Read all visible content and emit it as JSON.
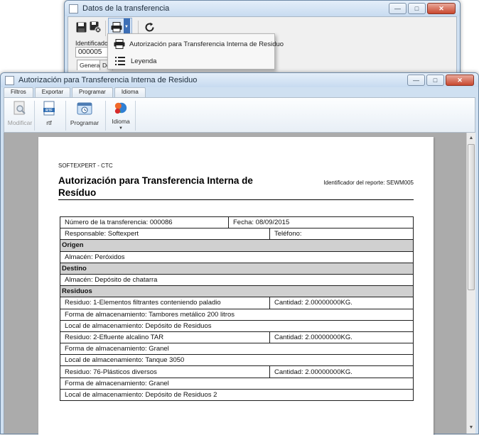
{
  "back_window": {
    "title": "Datos de la transferencia",
    "identifier_label": "Identificador",
    "identifier_value": "000005",
    "tabs": [
      "General",
      "De"
    ]
  },
  "print_menu": {
    "items": [
      {
        "label": "Autorización para Transferencia Interna de Residuo",
        "icon": "printer-icon"
      },
      {
        "label": "Leyenda",
        "icon": "list-icon"
      }
    ]
  },
  "report_window": {
    "title": "Autorización para Transferencia Interna de Residuo",
    "ribbon_tabs": [
      "Filtros",
      "Exportar",
      "Programar",
      "Idioma"
    ],
    "ribbon_buttons": [
      {
        "label": "Modificar",
        "icon": "magnifier-document-icon",
        "enabled": false
      },
      {
        "label": "rtf",
        "icon": "rtf-file-icon",
        "enabled": true
      },
      {
        "label": "Programar",
        "icon": "schedule-clock-icon",
        "enabled": true
      },
      {
        "label": "Idioma",
        "icon": "globe-language-icon",
        "enabled": true
      }
    ]
  },
  "report": {
    "company": "SOFTEXPERT - CTC",
    "title": "Autorización para Transferencia Interna de Resíduo",
    "report_id": "Identificador del reporte: SEWM005",
    "transfer_number": "Número de la transferencia: 000086",
    "date": "Fecha: 08/09/2015",
    "responsible": "Responsable: Softexpert",
    "phone": "Teléfono:",
    "origin_header": "Origen",
    "origin_warehouse": "Almacén: Peróxidos",
    "destination_header": "Destino",
    "destination_warehouse": "Almacén: Depósito de chatarra",
    "residues_header": "Residuos",
    "residues": [
      {
        "residue": "Residuo: 1-Elementos filtrantes conteniendo paladio",
        "quantity": "Cantidad: 2.00000000KG.",
        "storage_form": "Forma de almacenamiento: Tambores metálico 200 litros",
        "storage_location": "Local de almacenamiento: Depósito de Residuos"
      },
      {
        "residue": "Residuo: 2-Efluente alcalino TAR",
        "quantity": "Cantidad: 2.00000000KG.",
        "storage_form": "Forma de almacenamiento: Granel",
        "storage_location": "Local de almacenamiento: Tanque 3050"
      },
      {
        "residue": "Residuo: 76-Plásticos diversos",
        "quantity": "Cantidad: 2.00000000KG.",
        "storage_form": "Forma de almacenamiento: Granel",
        "storage_location": "Local de almacenamiento: Depósito de Residuos 2"
      }
    ]
  },
  "colors": {
    "window_frame": "#cfe0f1",
    "section_header_bg": "#d0d0d0",
    "report_background": "#ababab",
    "toolbar_selected": "#3d6fb6"
  }
}
